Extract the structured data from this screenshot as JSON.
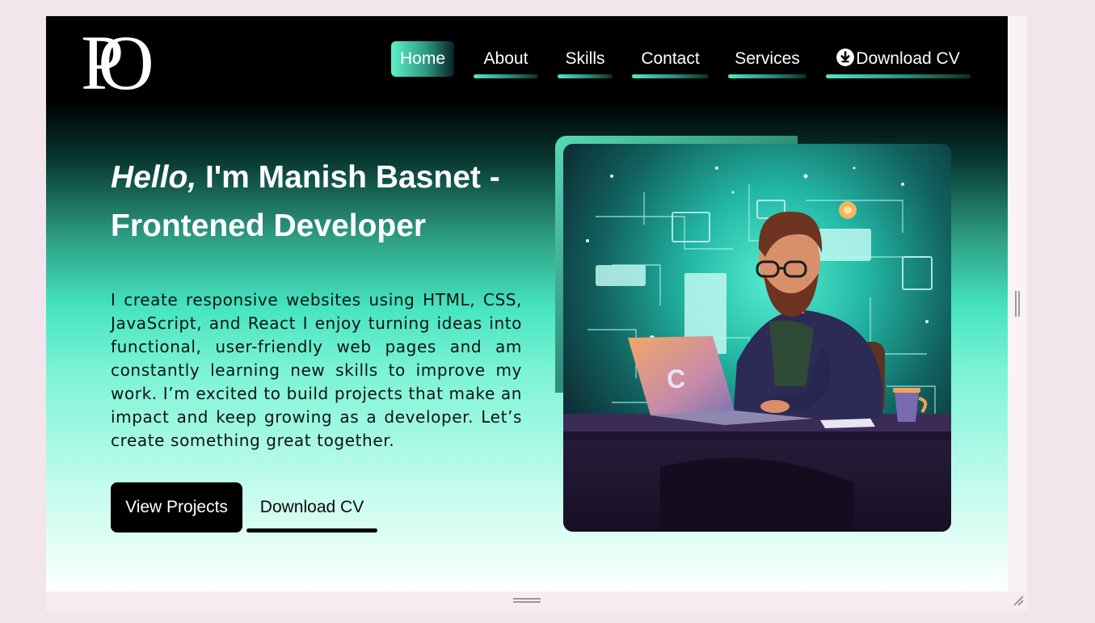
{
  "logo": {
    "text": "PO"
  },
  "nav": {
    "items": [
      {
        "label": "Home",
        "active": true
      },
      {
        "label": "About"
      },
      {
        "label": "Skills"
      },
      {
        "label": "Contact"
      },
      {
        "label": "Services"
      },
      {
        "label": "Download CV",
        "icon": "download-icon"
      }
    ]
  },
  "hero": {
    "hello": "Hello,",
    "headline_rest": " I'm Manish Basnet -",
    "headline_line2": "Frontened Developer",
    "bio": "I create responsive websites using HTML, CSS, JavaScript, and React I enjoy turning ideas into functional, user-friendly web pages and am constantly learning new skills to improve my work. I’m excited to build projects that make an impact and keep growing as a developer. Let’s create something great together.",
    "btn_projects": "View Projects",
    "btn_cv": "Download CV",
    "illustration_laptop_letter": "C"
  },
  "colors": {
    "accent": "#46e4c0",
    "nav_bg": "#000000",
    "button_dark": "#000000"
  }
}
